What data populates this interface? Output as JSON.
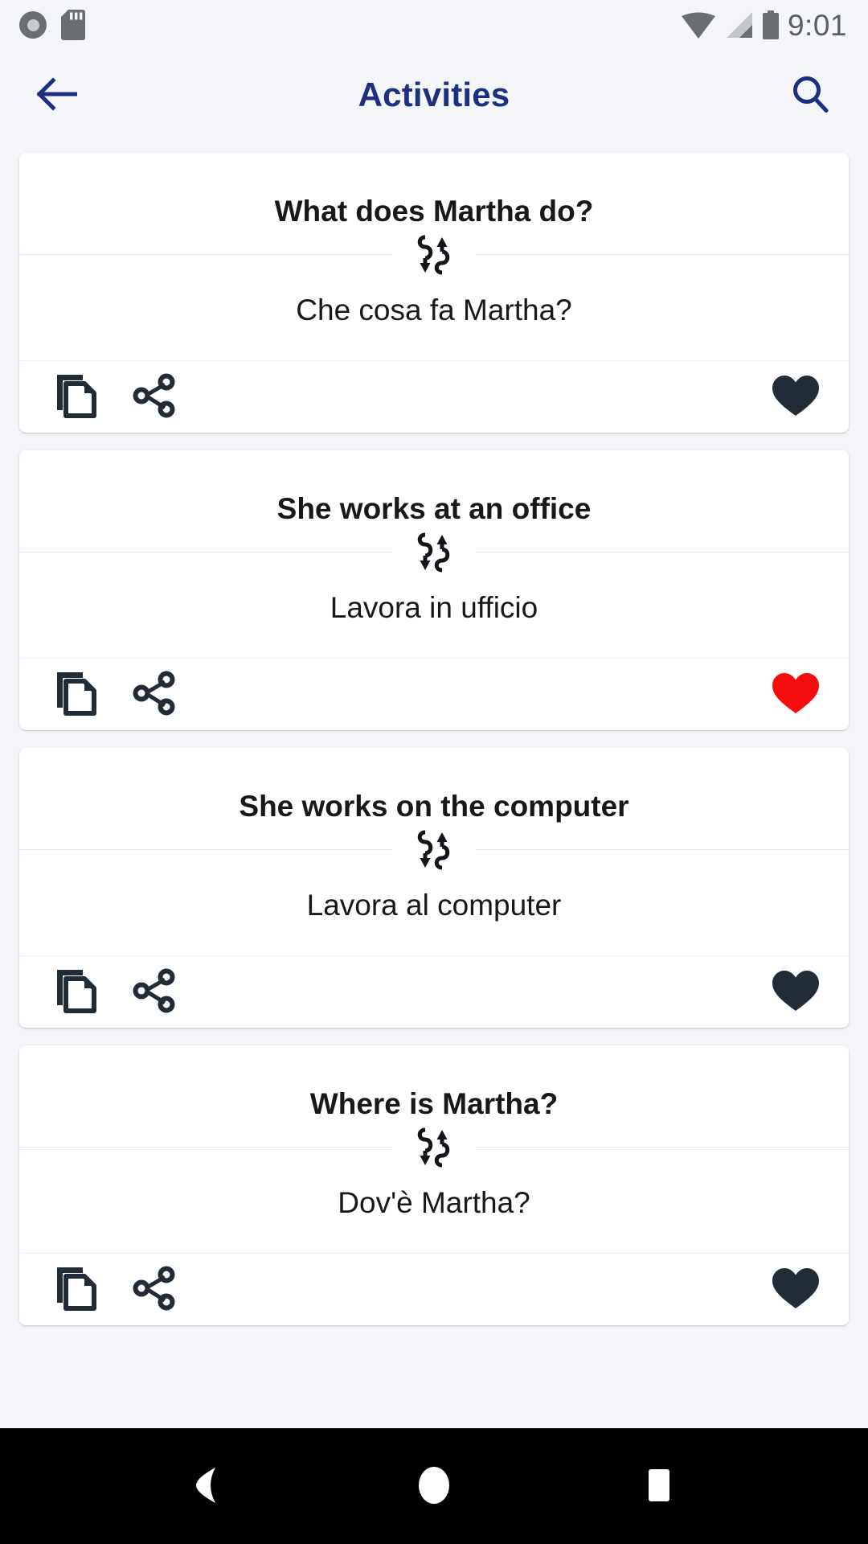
{
  "status_bar": {
    "time": "9:01",
    "icons": [
      "record-circle-icon",
      "sd-card-icon",
      "wifi-icon",
      "cellular-signal-icon",
      "battery-icon"
    ]
  },
  "app_bar": {
    "title": "Activities",
    "back_icon": "arrow-left-icon",
    "search_icon": "search-icon",
    "title_color": "#1d3080"
  },
  "colors": {
    "page_background": "#f4f6fa",
    "card_background": "#ffffff",
    "text_primary": "#17181a",
    "icon_dark": "#222c37",
    "favorite_active": "#f50d0d",
    "divider": "#e7e9ee"
  },
  "cards": [
    {
      "source_text": "What does Martha do?",
      "target_text": "Che cosa fa Martha?",
      "swap_icon": "swap-vertical-arrows-icon",
      "copy_icon": "copy-icon",
      "share_icon": "share-icon",
      "favorite_icon": "heart-icon",
      "favorited": false,
      "heart_color": "#222c37"
    },
    {
      "source_text": "She works at an office",
      "target_text": "Lavora in ufficio",
      "swap_icon": "swap-vertical-arrows-icon",
      "copy_icon": "copy-icon",
      "share_icon": "share-icon",
      "favorite_icon": "heart-icon",
      "favorited": true,
      "heart_color": "#f50d0d"
    },
    {
      "source_text": "She works on the computer",
      "target_text": "Lavora al computer",
      "swap_icon": "swap-vertical-arrows-icon",
      "copy_icon": "copy-icon",
      "share_icon": "share-icon",
      "favorite_icon": "heart-icon",
      "favorited": false,
      "heart_color": "#222c37"
    },
    {
      "source_text": "Where is Martha?",
      "target_text": "Dov'è Martha?",
      "swap_icon": "swap-vertical-arrows-icon",
      "copy_icon": "copy-icon",
      "share_icon": "share-icon",
      "favorite_icon": "heart-icon",
      "favorited": false,
      "heart_color": "#222c37"
    }
  ],
  "nav_bar": {
    "back_icon": "nav-back-triangle-icon",
    "home_icon": "nav-home-circle-icon",
    "recents_icon": "nav-recents-square-icon"
  }
}
